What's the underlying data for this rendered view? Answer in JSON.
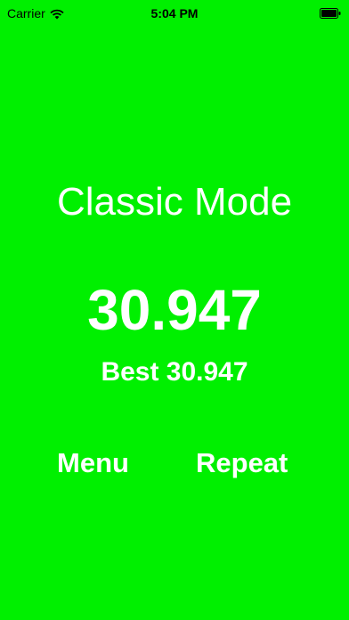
{
  "status_bar": {
    "carrier": "Carrier",
    "time": "5:04 PM",
    "wifi_icon": "wifi-icon",
    "battery_icon": "battery-icon"
  },
  "result": {
    "mode_title": "Classic Mode",
    "score": "30.947",
    "best": "Best 30.947"
  },
  "buttons": {
    "menu": "Menu",
    "repeat": "Repeat"
  },
  "colors": {
    "background": "#00f000",
    "text": "#ffffff"
  }
}
